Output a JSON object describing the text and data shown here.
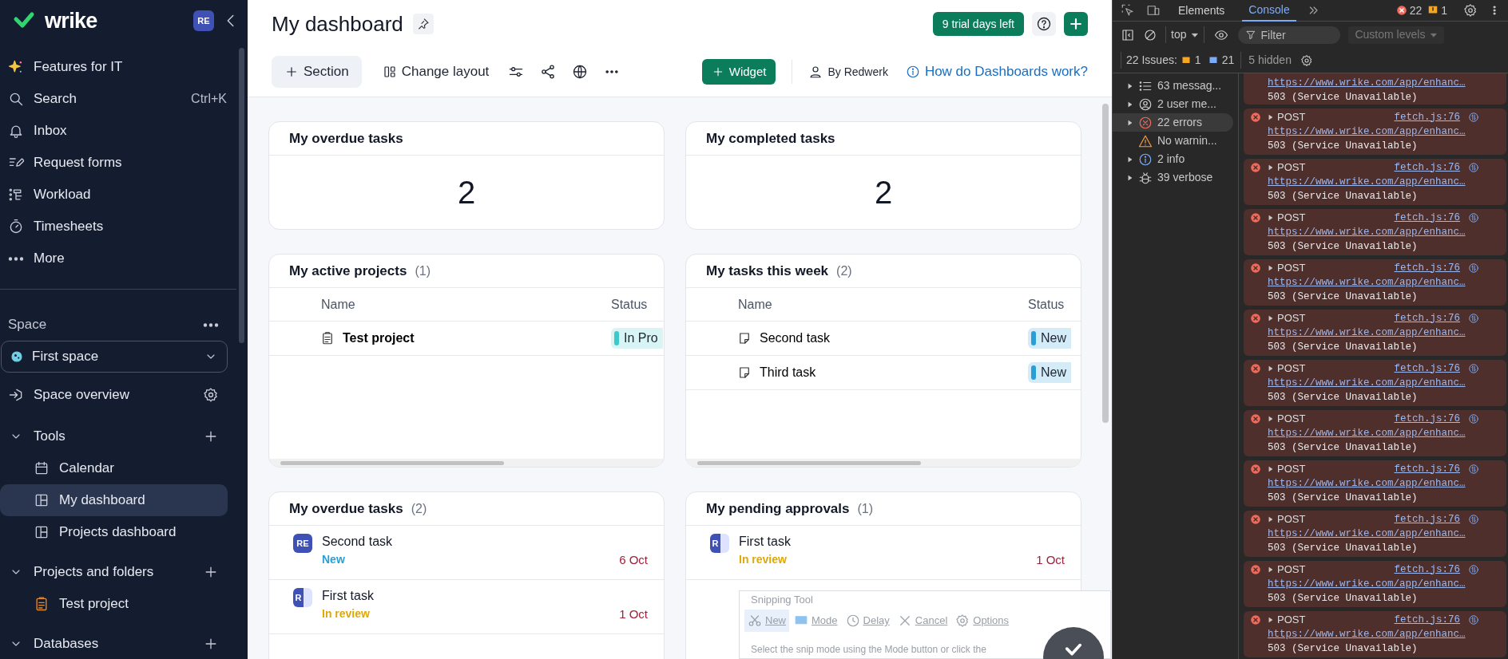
{
  "sidebar": {
    "logo": "wrike",
    "avatar": "RE",
    "nav": [
      {
        "label": "Features for IT"
      },
      {
        "label": "Search",
        "shortcut": "Ctrl+K"
      },
      {
        "label": "Inbox"
      },
      {
        "label": "Request forms"
      },
      {
        "label": "Workload"
      },
      {
        "label": "Timesheets"
      },
      {
        "label": "More"
      }
    ],
    "space_label": "Space",
    "space_selector": "First space",
    "space_overview": "Space overview",
    "sections": [
      {
        "label": "Tools",
        "expanded": true,
        "children": [
          {
            "label": "Calendar",
            "selected": false
          },
          {
            "label": "My dashboard",
            "selected": true
          },
          {
            "label": "Projects dashboard",
            "selected": false
          }
        ]
      },
      {
        "label": "Projects and folders",
        "expanded": true,
        "children": [
          {
            "label": "Test project",
            "selected": false
          }
        ]
      },
      {
        "label": "Databases",
        "expanded": true
      }
    ]
  },
  "header": {
    "title": "My dashboard",
    "trial": "9 trial days left",
    "toolbar": {
      "section": "Section",
      "change_layout": "Change layout",
      "widget": "Widget",
      "owner": "By Redwerk",
      "help": "How do Dashboards work?"
    }
  },
  "widgets": [
    {
      "kind": "number",
      "title": "My overdue tasks",
      "value": "2"
    },
    {
      "kind": "number",
      "title": "My completed tasks",
      "value": "2"
    },
    {
      "kind": "table",
      "title": "My active projects",
      "count": "(1)",
      "columns": [
        "Name",
        "Status"
      ],
      "rows": [
        {
          "kind": "project",
          "name": "Test project",
          "status": {
            "label": "In Pro",
            "color": "#3cc9c9"
          }
        }
      ]
    },
    {
      "kind": "table",
      "title": "My tasks this week",
      "count": "(2)",
      "columns": [
        "Name",
        "Status"
      ],
      "rows": [
        {
          "kind": "task",
          "name": "Second task",
          "status": {
            "label": "New",
            "color": "#2a9fd6"
          }
        },
        {
          "kind": "task",
          "name": "Third task",
          "status": {
            "label": "New",
            "color": "#2a9fd6"
          }
        }
      ]
    },
    {
      "kind": "list",
      "title": "My overdue tasks",
      "count": "(2)",
      "items": [
        {
          "avatar": "RE",
          "kind": "full",
          "name": "Second task",
          "status": {
            "label": "New",
            "color": "#2a9fd6"
          },
          "date": "6 Oct"
        },
        {
          "avatar": "R",
          "kind": "split",
          "name": "First task",
          "status": {
            "label": "In review",
            "color": "#e0a800"
          },
          "date": "1 Oct"
        }
      ]
    },
    {
      "kind": "list",
      "title": "My pending approvals",
      "count": "(1)",
      "items": [
        {
          "avatar": "R",
          "kind": "split",
          "name": "First task",
          "status": {
            "label": "In review",
            "color": "#e0a800"
          },
          "date": "1 Oct"
        }
      ]
    }
  ],
  "snipping_tool": {
    "title": "Snipping Tool",
    "buttons": [
      "New",
      "Mode",
      "Delay",
      "Cancel",
      "Options"
    ],
    "hint": "Select the snip mode using the Mode button or click the"
  },
  "devtools": {
    "tabs": [
      {
        "label": "Elements",
        "selected": false
      },
      {
        "label": "Console",
        "selected": true
      }
    ],
    "error_count": "22",
    "warning_count": "1",
    "context": "top",
    "filter_placeholder": "Filter",
    "levels": "Custom levels",
    "issues": {
      "label": "22 Issues:",
      "warnings": "1",
      "infos": "21",
      "hidden": "5 hidden"
    },
    "groups": [
      {
        "kind": "messages",
        "label": "63 messag...",
        "selected": false
      },
      {
        "kind": "user",
        "label": "2 user me...",
        "selected": false
      },
      {
        "kind": "errors",
        "label": "22 errors",
        "selected": true
      },
      {
        "kind": "warnings",
        "label": "No warnin...",
        "selected": false
      },
      {
        "kind": "info",
        "label": "2 info",
        "selected": false
      },
      {
        "kind": "verbose",
        "label": "39 verbose",
        "selected": false
      }
    ],
    "messages": [
      {
        "url": "https://www.wrike.com/app/enhanc…",
        "status": "503 (Service Unavailable)"
      },
      {
        "method": "POST",
        "source": "fetch.js:76",
        "url": "https://www.wrike.com/app/enhanc…",
        "status": "503 (Service Unavailable)"
      },
      {
        "method": "POST",
        "source": "fetch.js:76",
        "url": "https://www.wrike.com/app/enhanc…",
        "status": "503 (Service Unavailable)"
      },
      {
        "method": "POST",
        "source": "fetch.js:76",
        "url": "https://www.wrike.com/app/enhanc…",
        "status": "503 (Service Unavailable)"
      },
      {
        "method": "POST",
        "source": "fetch.js:76",
        "url": "https://www.wrike.com/app/enhanc…",
        "status": "503 (Service Unavailable)"
      },
      {
        "method": "POST",
        "source": "fetch.js:76",
        "url": "https://www.wrike.com/app/enhanc…",
        "status": "503 (Service Unavailable)"
      },
      {
        "method": "POST",
        "source": "fetch.js:76",
        "url": "https://www.wrike.com/app/enhanc…",
        "status": "503 (Service Unavailable)"
      },
      {
        "method": "POST",
        "source": "fetch.js:76",
        "url": "https://www.wrike.com/app/enhanc…",
        "status": "503 (Service Unavailable)"
      },
      {
        "method": "POST",
        "source": "fetch.js:76",
        "url": "https://www.wrike.com/app/enhanc…",
        "status": "503 (Service Unavailable)"
      },
      {
        "method": "POST",
        "source": "fetch.js:76",
        "url": "https://www.wrike.com/app/enhanc…",
        "status": "503 (Service Unavailable)"
      },
      {
        "method": "POST",
        "source": "fetch.js:76",
        "url": "https://www.wrike.com/app/enhanc…",
        "status": "503 (Service Unavailable)"
      },
      {
        "method": "POST",
        "source": "fetch.js:76",
        "url": "https://www.wrike.com/app/enhanc…",
        "status": "503 (Service Unavailable)"
      }
    ]
  }
}
